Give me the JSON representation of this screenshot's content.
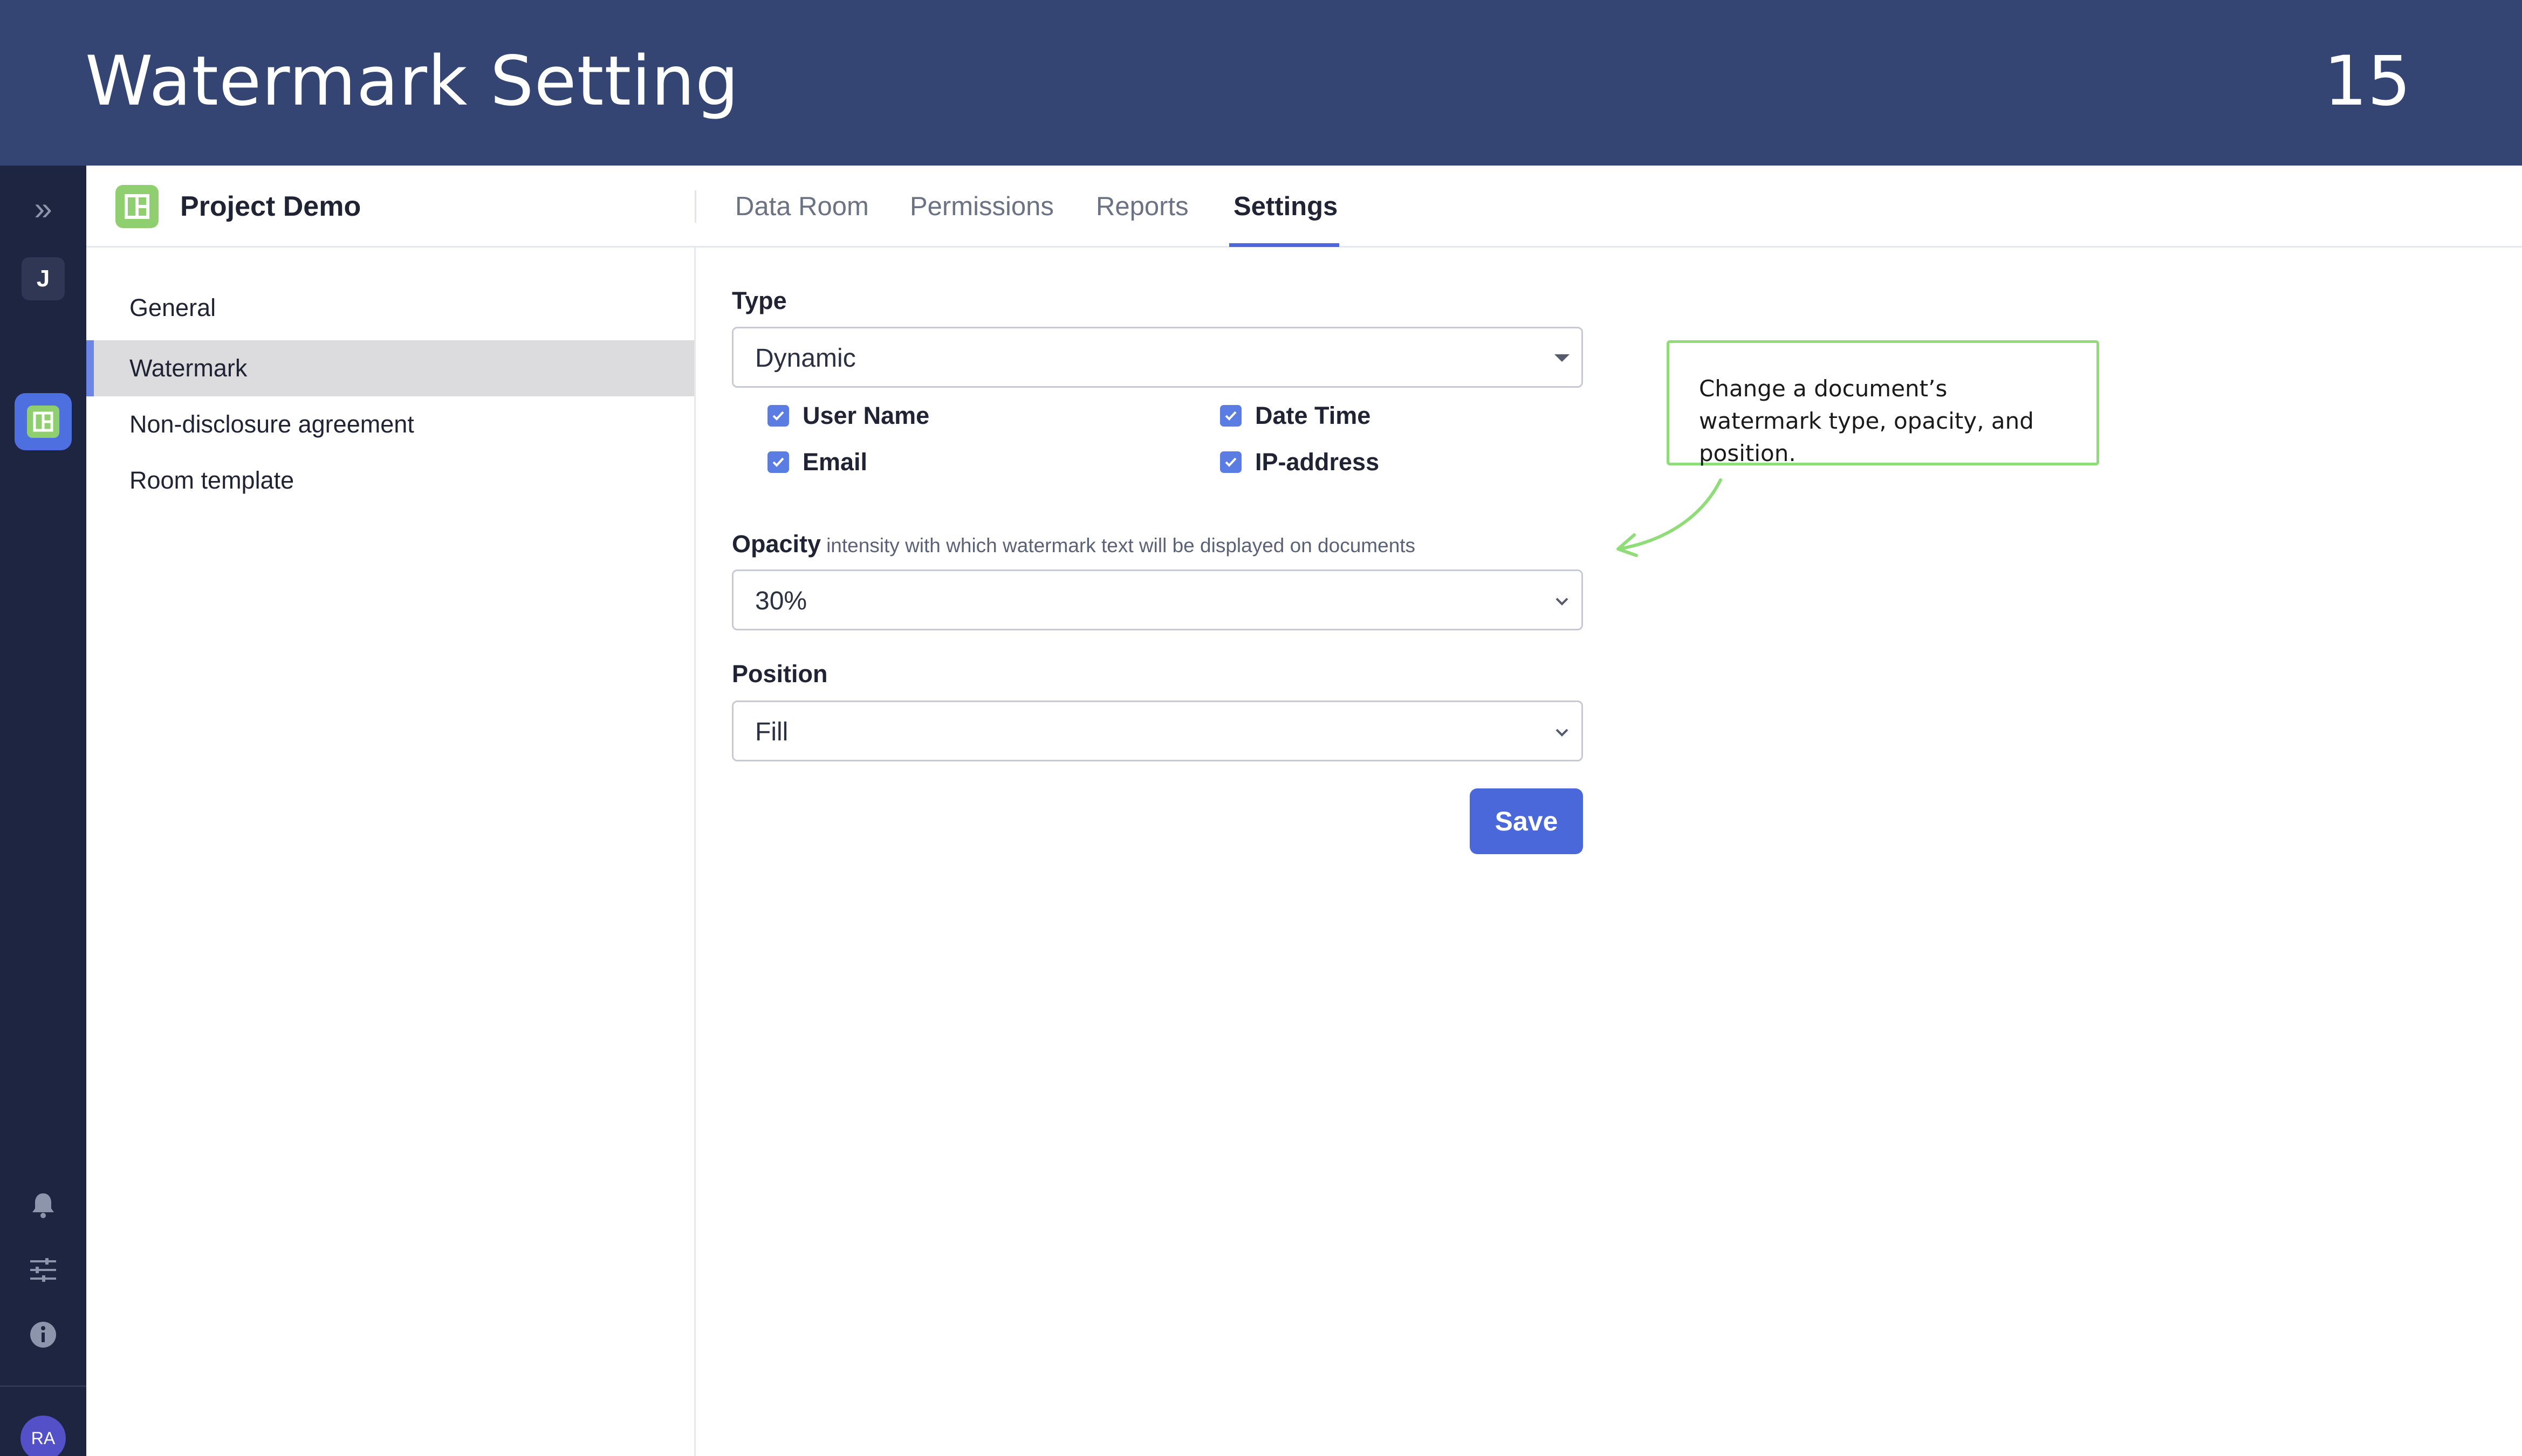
{
  "banner": {
    "title": "Watermark Setting",
    "page_number": "15"
  },
  "rail": {
    "expand_glyph": "»",
    "user_initial": "J",
    "avatar_initials": "RA",
    "icons": [
      "expand-icon",
      "bell-icon",
      "sliders-icon",
      "info-icon"
    ]
  },
  "header": {
    "project_name": "Project Demo",
    "tabs": [
      {
        "label": "Data Room"
      },
      {
        "label": "Permissions"
      },
      {
        "label": "Reports"
      },
      {
        "label": "Settings",
        "active": true
      }
    ]
  },
  "subnav": {
    "items": [
      {
        "label": "General"
      },
      {
        "label": "Watermark",
        "active": true
      },
      {
        "label": "Non-disclosure agreement"
      },
      {
        "label": "Room template"
      }
    ]
  },
  "form": {
    "type": {
      "label": "Type",
      "value": "Dynamic",
      "options": [
        {
          "label": "User Name",
          "checked": true
        },
        {
          "label": "Date Time",
          "checked": true
        },
        {
          "label": "Email",
          "checked": true
        },
        {
          "label": "IP-address",
          "checked": true
        }
      ]
    },
    "opacity": {
      "label": "Opacity",
      "hint": "intensity with which watermark text will be displayed on documents",
      "value": "30%"
    },
    "position": {
      "label": "Position",
      "value": "Fill"
    },
    "save_label": "Save"
  },
  "callout": {
    "text": "Change a document’s watermark type, opacity, and position."
  },
  "colors": {
    "banner": "#344574",
    "rail": "#1d2541",
    "accent": "#4a68d9",
    "project_green": "#8fcf6f",
    "callout_border": "#8fdc78",
    "selected_row": "#dcdcdf"
  }
}
